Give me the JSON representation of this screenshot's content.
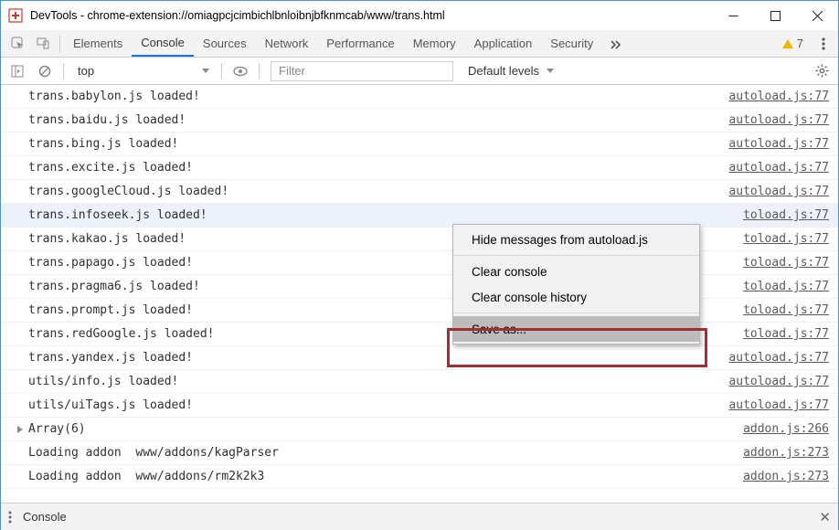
{
  "window": {
    "title": "DevTools - chrome-extension://omiagpcjcimbichlbnloibnjbfknmcab/www/trans.html"
  },
  "tabs": {
    "elements": "Elements",
    "console": "Console",
    "sources": "Sources",
    "network": "Network",
    "performance": "Performance",
    "memory": "Memory",
    "application": "Application",
    "security": "Security",
    "warn_count": "7"
  },
  "toolbar": {
    "scope": "top",
    "filter_placeholder": "Filter",
    "levels": "Default levels"
  },
  "rows": [
    {
      "msg": "trans.babylon.js loaded!",
      "src": "autoload.js:77",
      "h": false
    },
    {
      "msg": "trans.baidu.js loaded!",
      "src": "autoload.js:77",
      "h": false
    },
    {
      "msg": "trans.bing.js loaded!",
      "src": "autoload.js:77",
      "h": false
    },
    {
      "msg": "trans.excite.js loaded!",
      "src": "autoload.js:77",
      "h": false
    },
    {
      "msg": "trans.googleCloud.js loaded!",
      "src": "autoload.js:77",
      "h": false
    },
    {
      "msg": "trans.infoseek.js loaded!",
      "src": "toload.js:77",
      "h": true
    },
    {
      "msg": "trans.kakao.js loaded!",
      "src": "toload.js:77",
      "h": false
    },
    {
      "msg": "trans.papago.js loaded!",
      "src": "toload.js:77",
      "h": false
    },
    {
      "msg": "trans.pragma6.js loaded!",
      "src": "toload.js:77",
      "h": false
    },
    {
      "msg": "trans.prompt.js loaded!",
      "src": "toload.js:77",
      "h": false
    },
    {
      "msg": "trans.redGoogle.js loaded!",
      "src": "toload.js:77",
      "h": false
    },
    {
      "msg": "trans.yandex.js loaded!",
      "src": "autoload.js:77",
      "h": false
    },
    {
      "msg": "utils/info.js loaded!",
      "src": "autoload.js:77",
      "h": false
    },
    {
      "msg": "utils/uiTags.js loaded!",
      "src": "autoload.js:77",
      "h": false
    },
    {
      "msg": "Array(6)",
      "src": "addon.js:266",
      "h": false,
      "expand": true
    },
    {
      "msg": "Loading addon  www/addons/kagParser",
      "src": "addon.js:273",
      "h": false
    },
    {
      "msg": "Loading addon  www/addons/rm2k2k3",
      "src": "addon.js:273",
      "h": false
    },
    {
      "msg": " ",
      "src": " ",
      "h": false
    }
  ],
  "ctx": {
    "hide": "Hide messages from autoload.js",
    "clear": "Clear console",
    "hist": "Clear console history",
    "save": "Save as..."
  },
  "drawer": {
    "label": "Console"
  }
}
